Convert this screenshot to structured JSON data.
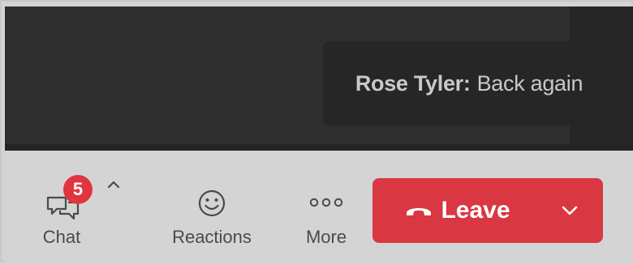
{
  "notification": {
    "sender": "Rose Tyler:",
    "message": "Back again"
  },
  "toolbar": {
    "chat": {
      "label": "Chat",
      "badge_count": "5",
      "icon": "chat-bubbles-icon",
      "badge_color": "#e0353f"
    },
    "reactions": {
      "label": "Reactions",
      "icon": "smiley-icon"
    },
    "more": {
      "label": "More",
      "icon": "ellipsis-icon"
    },
    "leave": {
      "label": "Leave",
      "icon": "phone-hangup-icon",
      "color": "#d93742"
    }
  }
}
